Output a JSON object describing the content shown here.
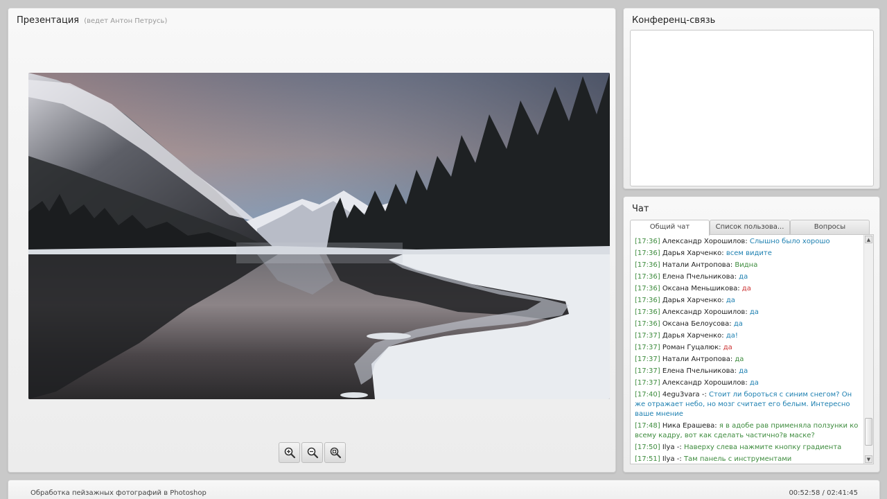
{
  "presentation": {
    "title": "Презентация",
    "presenter": "(ведет Антон   Петрусь)"
  },
  "conference": {
    "title": "Конференц-связь"
  },
  "chat": {
    "title": "Чат",
    "tabs": [
      "Общий чат",
      "Список пользова...",
      "Вопросы"
    ],
    "active_tab": 0,
    "messages": [
      {
        "time": "[17:36]",
        "author": "Александр Хорошилов:",
        "text": "Слышно было хорошо",
        "color": "blue"
      },
      {
        "time": "[17:36]",
        "author": "Дарья Харченко:",
        "text": "всем видите",
        "color": "blue"
      },
      {
        "time": "[17:36]",
        "author": "Натали Антропова:",
        "text": "Видна",
        "color": "green"
      },
      {
        "time": "[17:36]",
        "author": "Елена Пчельникова:",
        "text": "да",
        "color": "blue"
      },
      {
        "time": "[17:36]",
        "author": "Оксана Меньшикова:",
        "text": "да",
        "color": "red"
      },
      {
        "time": "[17:36]",
        "author": "Дарья Харченко:",
        "text": "да",
        "color": "blue"
      },
      {
        "time": "[17:36]",
        "author": "Александр Хорошилов:",
        "text": "да",
        "color": "blue"
      },
      {
        "time": "[17:36]",
        "author": "Оксана Белоусова:",
        "text": "да",
        "color": "blue"
      },
      {
        "time": "[17:37]",
        "author": "Дарья Харченко:",
        "text": "да!",
        "color": "blue"
      },
      {
        "time": "[17:37]",
        "author": "Роман Гуцалюк:",
        "text": "да",
        "color": "red"
      },
      {
        "time": "[17:37]",
        "author": "Натали Антропова:",
        "text": "да",
        "color": "green"
      },
      {
        "time": "[17:37]",
        "author": "Елена Пчельникова:",
        "text": "да",
        "color": "blue"
      },
      {
        "time": "[17:37]",
        "author": "Александр Хорошилов:",
        "text": "да",
        "color": "blue"
      },
      {
        "time": "[17:40]",
        "author": "4egu3vara -:",
        "text": "Стоит ли бороться с синим снегом? Он же отражает небо, но мозг считает его белым. Интересно ваше мнение",
        "color": "blue"
      },
      {
        "time": "[17:48]",
        "author": "Ника Ерашева:",
        "text": "я в адобе рав применяла ползунки ко всему кадру, вот как сделать частично?в маске?",
        "color": "green"
      },
      {
        "time": "[17:50]",
        "author": "Ilya -:",
        "text": "Наверху слева нажмите кнопку градиента",
        "color": "green"
      },
      {
        "time": "[17:51]",
        "author": "Ilya -:",
        "text": "Там панель с инструментами",
        "color": "green"
      }
    ]
  },
  "footer": {
    "course_title": "Обработка пейзажных фотографий в Photoshop",
    "timer": "00:52:58 / 02:41:45"
  },
  "zoom": {
    "icons": [
      "zoom-in-icon",
      "zoom-out-icon",
      "zoom-fit-icon"
    ]
  },
  "colors": {
    "time": "#3d8b3d",
    "blue": "#1c7fb0",
    "green": "#3d8b3d",
    "red": "#cc3333"
  }
}
